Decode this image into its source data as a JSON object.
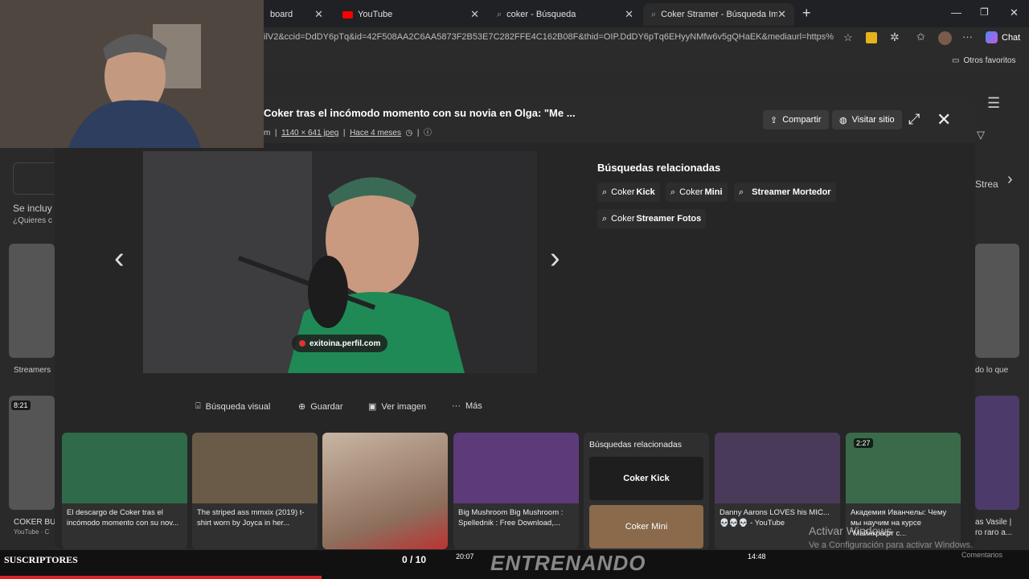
{
  "tabs": [
    {
      "label": "board"
    },
    {
      "label": "YouTube"
    },
    {
      "label": "coker - Búsqueda"
    },
    {
      "label": "Coker Stramer - Búsqueda Imágen"
    }
  ],
  "address": {
    "url": "ilV2&ccid=DdDY6pTq&id=42F508AA2C6AA5873F2B53E7C282FFE4C162B08F&thid=OIP.DdDY6pTq6EHyyNMfw6v5gQHaEK&mediaurl=https%..."
  },
  "browser": {
    "chat": "Chat",
    "favorites": "Otros favoritos"
  },
  "modal": {
    "title": "Coker tras el incómodo momento con su novia en Olga: \"Me ...",
    "meta_prefix": "m",
    "dimensions": "1140 × 641 jpeg",
    "age": "Hace 4 meses",
    "share": "Compartir",
    "visit": "Visitar sitio",
    "source": "exitoina.perfil.com",
    "related_title": "Búsquedas relacionadas",
    "related": [
      {
        "prefix": "Coker ",
        "bold": "Kick"
      },
      {
        "prefix": "Coker ",
        "bold": "Mini"
      },
      {
        "prefix": "",
        "bold": "Streamer Mortedor"
      },
      {
        "prefix": "Coker ",
        "bold": "Streamer Fotos"
      }
    ],
    "actions": [
      "Búsqueda visual",
      "Guardar",
      "Ver imagen",
      "Más"
    ]
  },
  "carousel": [
    {
      "caption": "El descargo de Coker tras el incómodo momento con su nov..."
    },
    {
      "caption": "The striped ass mmxix (2019) t-shirt worn by Joyca in her..."
    },
    {
      "caption": ""
    },
    {
      "caption": "Big Mushroom Big Mushroom : Spellednik : Free Download,..."
    },
    {
      "caption": "Danny Aarons LOVES his MIC... 💀💀💀 - YouTube"
    },
    {
      "caption": "Академия Иванчелы: Чему мы научим на курсе \"Майнкрафт с..."
    }
  ],
  "carousel_related": {
    "title": "Búsquedas relacionadas",
    "items": [
      "Coker Kick",
      "Coker Mini"
    ]
  },
  "durations": {
    "left": "8:21",
    "right": "2:27",
    "bottom1": "20:07",
    "bottom2": "14:48"
  },
  "background_text": {
    "se_incluy": "Se incluy",
    "quieres": "¿Quieres c",
    "streamers": "Streamers",
    "coker_bu": "COKER BU",
    "youtube": "YouTube · C",
    "strea": "Strea",
    "dolo": "do lo que",
    "vasile": "as Vasile |",
    "raro": "ro raro a...",
    "comentarios": "Comentarios"
  },
  "overlay": {
    "subscribers": "SUSCRIPTORES",
    "count": "0 / 10",
    "banner": "ENTRENANDO",
    "activate": "Activar Windows",
    "activate_sub": "Ve a Configuración para activar Windows."
  }
}
